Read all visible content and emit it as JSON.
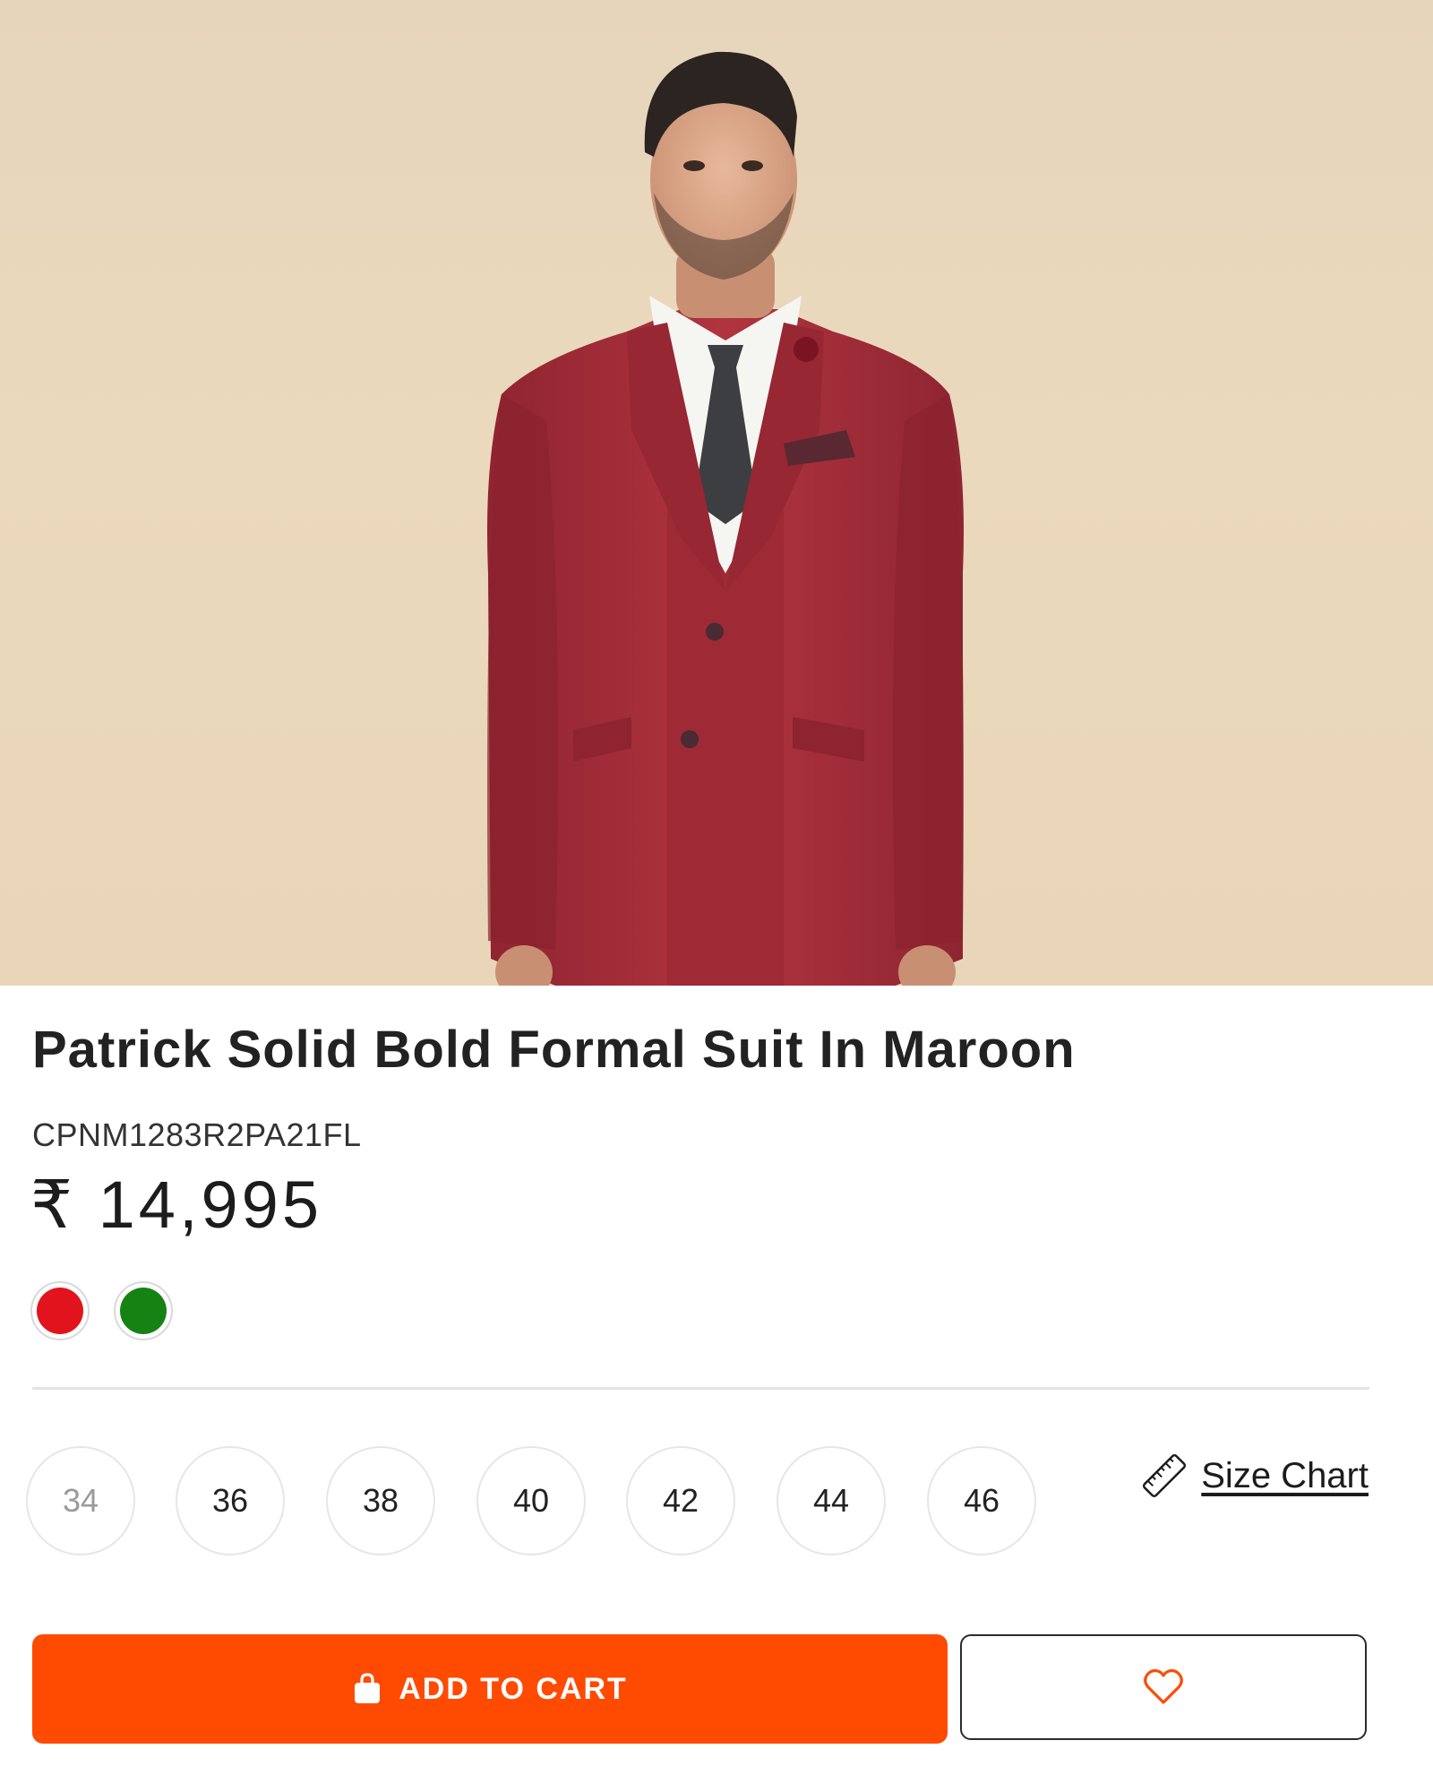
{
  "product": {
    "image_alt": "Man wearing a maroon three-piece suit",
    "title": "Patrick Solid Bold Formal Suit In Maroon",
    "sku": "CPNM1283R2PA21FL",
    "price": "₹ 14,995"
  },
  "colors": [
    {
      "name": "red-swatch",
      "hex": "#e1141d"
    },
    {
      "name": "green-swatch",
      "hex": "#168214"
    }
  ],
  "sizes": [
    {
      "label": "34",
      "available": false
    },
    {
      "label": "36",
      "available": true
    },
    {
      "label": "38",
      "available": true
    },
    {
      "label": "40",
      "available": true
    },
    {
      "label": "42",
      "available": true
    },
    {
      "label": "44",
      "available": true
    },
    {
      "label": "46",
      "available": true
    }
  ],
  "size_chart": {
    "label": "Size Chart",
    "icon": "ruler-icon"
  },
  "actions": {
    "add_to_cart": "ADD TO CART",
    "cart_icon": "shopping-bag-icon",
    "wishlist_icon": "heart-icon"
  },
  "theme": {
    "accent": "#ff4a02",
    "suit": "#a8303c"
  }
}
